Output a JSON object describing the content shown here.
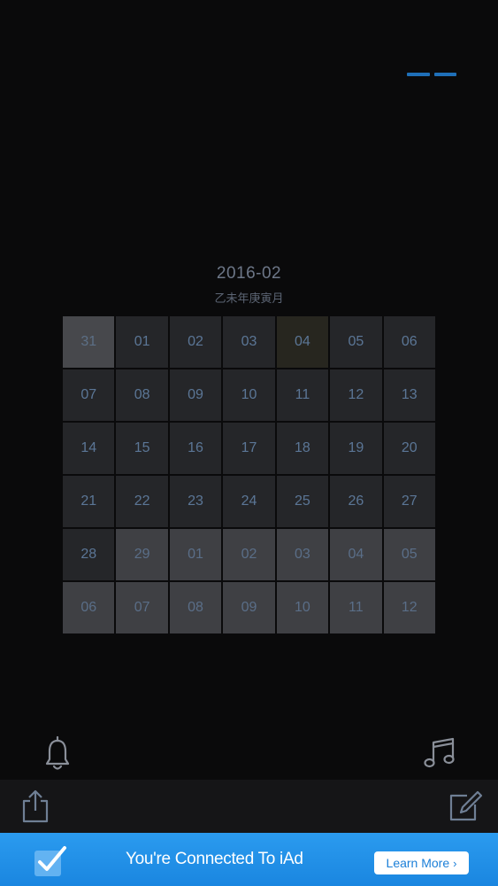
{
  "header": {
    "month": "2016-02",
    "lunar": "乙未年庚寅月"
  },
  "calendar": {
    "cells": [
      {
        "label": "31",
        "kind": "first"
      },
      {
        "label": "01",
        "kind": "current"
      },
      {
        "label": "02",
        "kind": "current"
      },
      {
        "label": "03",
        "kind": "current"
      },
      {
        "label": "04",
        "kind": "today"
      },
      {
        "label": "05",
        "kind": "current"
      },
      {
        "label": "06",
        "kind": "current"
      },
      {
        "label": "07",
        "kind": "current"
      },
      {
        "label": "08",
        "kind": "current"
      },
      {
        "label": "09",
        "kind": "current"
      },
      {
        "label": "10",
        "kind": "current"
      },
      {
        "label": "11",
        "kind": "current"
      },
      {
        "label": "12",
        "kind": "current"
      },
      {
        "label": "13",
        "kind": "current"
      },
      {
        "label": "14",
        "kind": "current"
      },
      {
        "label": "15",
        "kind": "current"
      },
      {
        "label": "16",
        "kind": "current"
      },
      {
        "label": "17",
        "kind": "current"
      },
      {
        "label": "18",
        "kind": "current"
      },
      {
        "label": "19",
        "kind": "current"
      },
      {
        "label": "20",
        "kind": "current"
      },
      {
        "label": "21",
        "kind": "current"
      },
      {
        "label": "22",
        "kind": "current"
      },
      {
        "label": "23",
        "kind": "current"
      },
      {
        "label": "24",
        "kind": "current"
      },
      {
        "label": "25",
        "kind": "current"
      },
      {
        "label": "26",
        "kind": "current"
      },
      {
        "label": "27",
        "kind": "current"
      },
      {
        "label": "28",
        "kind": "current"
      },
      {
        "label": "29",
        "kind": "other"
      },
      {
        "label": "01",
        "kind": "other"
      },
      {
        "label": "02",
        "kind": "other"
      },
      {
        "label": "03",
        "kind": "other"
      },
      {
        "label": "04",
        "kind": "other"
      },
      {
        "label": "05",
        "kind": "other"
      },
      {
        "label": "06",
        "kind": "other"
      },
      {
        "label": "07",
        "kind": "other"
      },
      {
        "label": "08",
        "kind": "other"
      },
      {
        "label": "09",
        "kind": "other"
      },
      {
        "label": "10",
        "kind": "other"
      },
      {
        "label": "11",
        "kind": "other"
      },
      {
        "label": "12",
        "kind": "other"
      }
    ]
  },
  "icons": {
    "menu": "menu-dashes-icon",
    "bell": "bell-icon",
    "music": "music-note-icon",
    "share": "share-icon",
    "edit": "edit-icon",
    "check": "checkmark-icon"
  },
  "ad": {
    "text": "You're Connected To iAd",
    "button_label": "Learn More",
    "button_chevron": "›"
  },
  "colors": {
    "accent": "#1f6fb8",
    "ad_background": "#2191e8",
    "background": "#0a0a0b"
  }
}
